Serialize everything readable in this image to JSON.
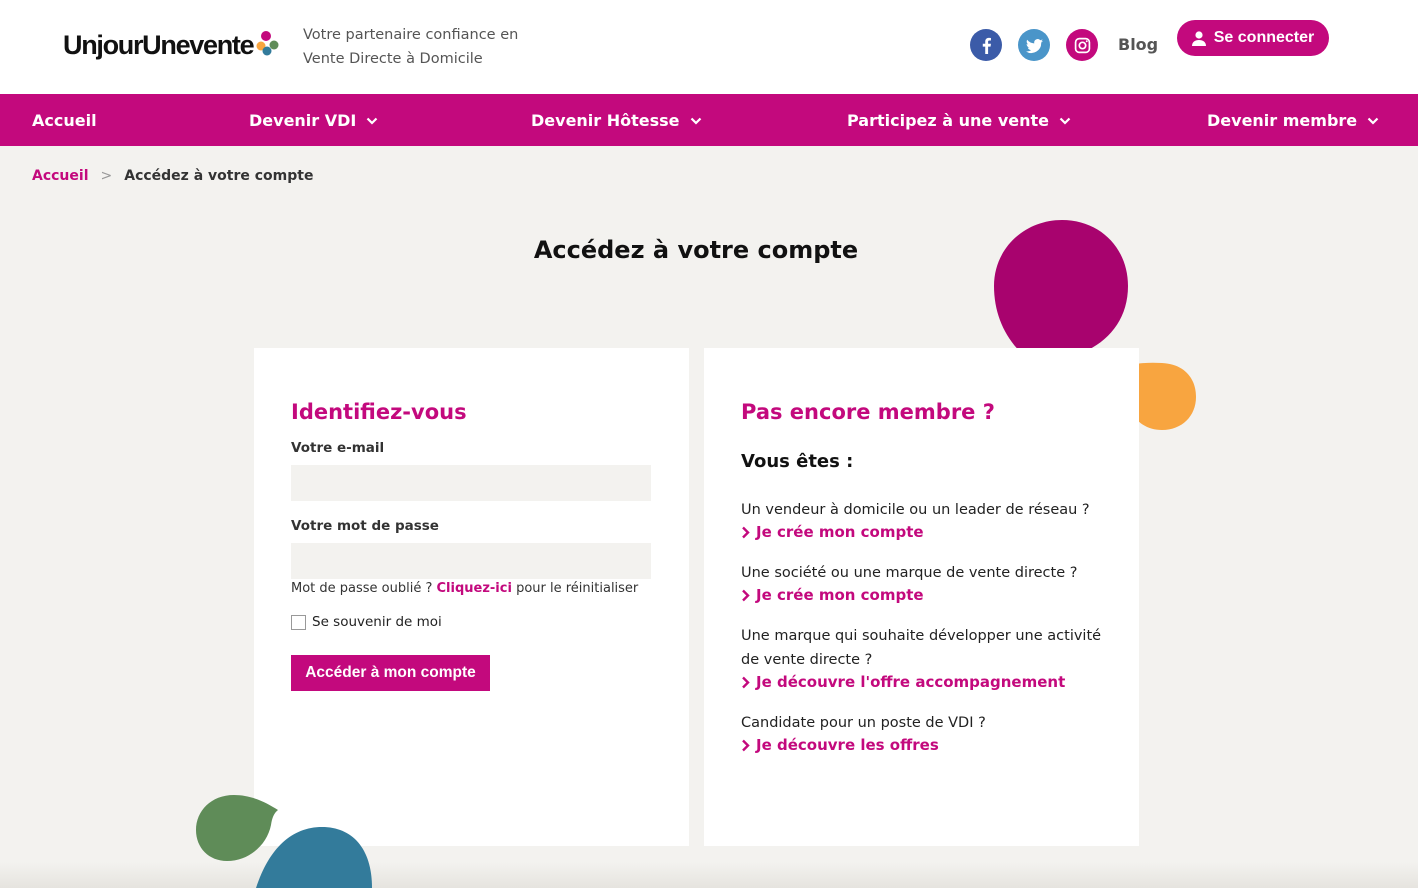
{
  "header": {
    "logo_text": "UnjourUnevente",
    "tagline_line1": "Votre partenaire confiance en",
    "tagline_line2": "Vente Directe à Domicile",
    "blog_label": "Blog",
    "login_label": "Se connecter"
  },
  "nav": {
    "items": [
      {
        "label": "Accueil"
      },
      {
        "label": "Devenir VDI"
      },
      {
        "label": "Devenir Hôtesse"
      },
      {
        "label": "Participez à une vente"
      },
      {
        "label": "Devenir membre"
      }
    ]
  },
  "breadcrumb": {
    "home": "Accueil",
    "separator": ">",
    "current": "Accédez à votre compte"
  },
  "page": {
    "title": "Accédez à votre compte"
  },
  "login": {
    "title": "Identifiez-vous",
    "email_label": "Votre e-mail",
    "email_value": "",
    "password_label": "Votre mot de passe",
    "password_value": "",
    "forgot_prefix": "Mot de passe oublié ?",
    "forgot_link": "Cliquez-ici",
    "forgot_suffix": "pour le réinitialiser",
    "remember_label": "Se souvenir de moi",
    "submit_label": "Accéder à mon compte"
  },
  "signup": {
    "title": "Pas encore membre ?",
    "subtitle": "Vous êtes :",
    "items": [
      {
        "question": "Un vendeur à domicile ou un leader de réseau ?",
        "cta": "Je crée mon compte"
      },
      {
        "question": "Une société ou une marque de vente directe ?",
        "cta": "Je crée mon compte"
      },
      {
        "question": "Une marque qui souhaite développer une activité de vente directe ?",
        "cta": "Je découvre l'offre accompagnement"
      },
      {
        "question": "Candidate pour un poste de VDI ?",
        "cta": "Je découvre les offres"
      }
    ]
  },
  "colors": {
    "brand": "#c3097d",
    "facebook": "#3b5ba8",
    "twitter": "#4a95c9",
    "blob_purple": "#a8036e",
    "blob_orange": "#f8a540",
    "blob_green": "#5f8c58",
    "blob_blue": "#337b9b"
  },
  "icons": [
    "facebook-icon",
    "twitter-icon",
    "instagram-icon",
    "user-icon",
    "chevron-down-icon",
    "chevron-right-icon"
  ]
}
